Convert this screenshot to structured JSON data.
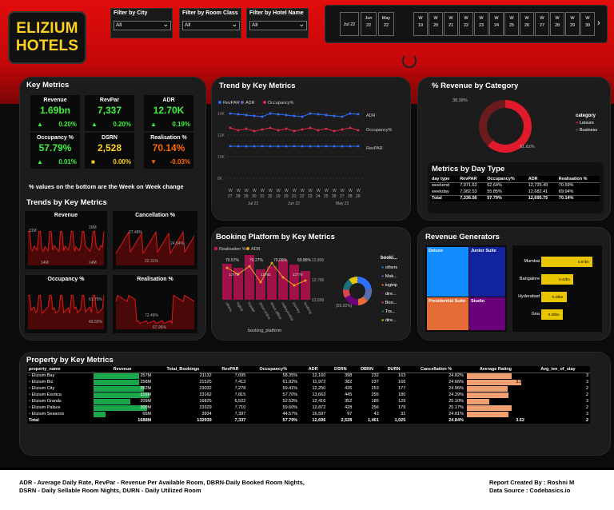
{
  "logo": {
    "line1": "ELIZIUM",
    "line2": "HOTELS"
  },
  "filters": [
    {
      "label": "Filter by City",
      "value": "All"
    },
    {
      "label": "Filter by Room Class",
      "value": "All"
    },
    {
      "label": "Filter by Hotel Name",
      "value": "All"
    }
  ],
  "months": [
    [
      "Jul 22",
      ""
    ],
    [
      "Jun",
      "22"
    ],
    [
      "May",
      "22"
    ]
  ],
  "weeks": [
    "W 19",
    "W 20",
    "W 21",
    "W 22",
    "W 23",
    "W 24",
    "W 25",
    "W 26",
    "W 27",
    "W 28",
    "W 29",
    "W 30"
  ],
  "key_metrics": {
    "title": "Key Metrics",
    "note": "% values on the bottom are the Week on Week change",
    "cards": [
      {
        "label": "Revenue",
        "value": "1.69bn",
        "change": "0.20%",
        "icon": "up-triangle",
        "color": "#3ff03f"
      },
      {
        "label": "RevPar",
        "value": "7,337",
        "change": "0.20%",
        "icon": "up-triangle",
        "color": "#3ff03f"
      },
      {
        "label": "ADR",
        "value": "12.70K",
        "change": "0.19%",
        "icon": "up-triangle",
        "color": "#3ff03f"
      },
      {
        "label": "Occupancy %",
        "value": "57.79%",
        "change": "0.01%",
        "icon": "up-triangle",
        "color": "#3ff03f"
      },
      {
        "label": "DSRN",
        "value": "2,528",
        "change": "0.00%",
        "icon": "square",
        "color": "#ffd21f"
      },
      {
        "label": "Realisation %",
        "value": "70.14%",
        "change": "-0.03%",
        "icon": "down-triangle",
        "color": "#ff6a00"
      }
    ]
  },
  "trends": {
    "title": "Trends by Key Metrics",
    "revenue": {
      "title": "Revenue",
      "labels": [
        "31M",
        "26M",
        "14M",
        "14M"
      ]
    },
    "cancellation": {
      "title": "Cancellation %",
      "labels": [
        "27.48%",
        "24.54%",
        "22.31%"
      ]
    },
    "occupancy": {
      "title": "Occupancy %",
      "labels": [
        "",
        "61.75%",
        "",
        "43.55%"
      ]
    },
    "realisation": {
      "title": "Realisation %",
      "labels": [
        "72.49%",
        "67.95%"
      ]
    }
  },
  "trend_key": {
    "title": "Trend by Key Metrics",
    "legend": [
      "RevPAR",
      "ADR",
      "Occupancy%"
    ],
    "series_labels": [
      "ADR",
      "Occupancy%",
      "RevPAR"
    ],
    "y_labels": [
      "14K",
      "12K",
      "10K",
      "8K"
    ],
    "x_labels": [
      "W 27",
      "W 28",
      "W 29",
      "W 30",
      "W 31",
      "W 32",
      "W 19",
      "W 20",
      "W 21",
      "W 22",
      "W 23",
      "W 24",
      "W 25",
      "W 26",
      "W 27",
      "W 28",
      "W 29"
    ],
    "month_labels": [
      "Jul 22",
      "Jun 22",
      "May 22"
    ]
  },
  "revenue_category": {
    "title": "% Revenue by Category",
    "legend_title": "category",
    "legend": [
      "Leisure",
      "Business"
    ],
    "pct_top": "38.38%",
    "pct_bottom": "61.62%",
    "slices": [
      61.62,
      38.38
    ]
  },
  "day_type": {
    "title": "Metrics by Day Type",
    "headers": [
      "day type",
      "RevPAR",
      "Occupancy%",
      "ADR",
      "Realisation %"
    ],
    "rows": [
      [
        "weekend",
        "7,971.63",
        "62.64%",
        "12,725.49",
        "70.59%"
      ],
      [
        "weekday",
        "7,082.53",
        "55.85%",
        "12,682.41",
        "69.94%"
      ],
      [
        "Total",
        "7,336.56",
        "57.79%",
        "12,695.75",
        "70.14%"
      ]
    ]
  },
  "booking": {
    "title": "Booking Platform by Key Metrics",
    "legend": [
      "Realisation %",
      "ADR"
    ],
    "x_title": "booking_platform",
    "platforms": [
      "others",
      "logtrip",
      "tripster",
      "direct online",
      "direct offline",
      "makeyourtrip",
      "journey",
      "booking"
    ],
    "pcts": [
      "70.57%",
      "70.27%",
      "70.09%",
      "69.86%"
    ],
    "right_axis": [
      "12,800",
      "12,700",
      "12,600"
    ],
    "bar_labels": [
      "12775",
      "12782",
      "12778"
    ],
    "donut_title": "booki...",
    "donut_legend": [
      "others",
      "Mak...",
      "logtrip",
      "dire...",
      "Boo...",
      "Tra...",
      "dire..."
    ],
    "donut_label": "(55.92%)"
  },
  "revenue_gen": {
    "title": "Revenue Generators",
    "tiles": [
      "Deluxe",
      "Junior Suite",
      "Presidential Suite",
      "Studio"
    ],
    "bars": [
      {
        "name": "Mumbai",
        "label": "0.67bn",
        "value": 0.67
      },
      {
        "name": "Bangalore",
        "label": "0.42bn",
        "value": 0.42
      },
      {
        "name": "Hyderabad",
        "label": "0.33bn",
        "value": 0.33
      },
      {
        "name": "Goa",
        "label": "0.28bn",
        "value": 0.28
      }
    ]
  },
  "property": {
    "title": "Property by Key Metrics",
    "headers": [
      "property_name",
      "Revenue",
      "Total_Bookings",
      "RevPAR",
      "Occupancy%",
      "ADR",
      "DSRN",
      "DBRN",
      "DURN",
      "Cancellation %",
      "Average Rating",
      "Avg_len_of_stay"
    ],
    "rows": [
      [
        "Elizium Bay",
        "257M",
        "21132",
        "7,095",
        "58.35%",
        "12,160",
        "398",
        "232",
        "163",
        "24.82%",
        "3.71",
        "3"
      ],
      [
        "Elizium Biz",
        "258M",
        "21525",
        "7,413",
        "61.92%",
        "11,972",
        "382",
        "237",
        "166",
        "24.66%",
        "3.96",
        "3"
      ],
      [
        "Elizium City",
        "282M",
        "23032",
        "7,278",
        "59.41%",
        "12,250",
        "426",
        "253",
        "177",
        "24.96%",
        "3.59",
        "2"
      ],
      [
        "Elizium Exotica",
        "316M",
        "23162",
        "7,815",
        "57.70%",
        "13,663",
        "445",
        "255",
        "180",
        "24.39%",
        "3.62",
        "2"
      ],
      [
        "Elizium Grands",
        "209M",
        "16825",
        "6,522",
        "52.53%",
        "12,416",
        "352",
        "185",
        "129",
        "25.10%",
        "3.10",
        "3"
      ],
      [
        "Elizium Palace",
        "300M",
        "23329",
        "7,710",
        "59.60%",
        "12,872",
        "428",
        "256",
        "179",
        "25.17%",
        "3.71",
        "2"
      ],
      [
        "Elizium Seasons",
        "66M",
        "3934",
        "7,397",
        "44.57%",
        "16,597",
        "97",
        "43",
        "31",
        "24.81%",
        "3.62",
        "3"
      ],
      [
        "Total",
        "1688M",
        "132939",
        "7,337",
        "57.79%",
        "12,696",
        "2,528",
        "1,461",
        "1,025",
        "24.84%",
        "3.62",
        "2"
      ]
    ],
    "revenue_values": [
      257,
      258,
      282,
      316,
      209,
      300,
      66
    ],
    "rating_values": [
      3.71,
      3.96,
      3.59,
      3.62,
      3.1,
      3.71,
      3.62
    ]
  },
  "footer": {
    "line1": "ADR - Average Daily Rate,   RevPar - Revenue Per Available Room,   DBRN-Daily Booked Room Nights,",
    "line2": "DSRN - Daily Sellable Room Nights,   DURN - Daily Utilized Room",
    "credit": "Report Created By : Roshni M",
    "source": "Data Source : Codebasics.io"
  }
}
